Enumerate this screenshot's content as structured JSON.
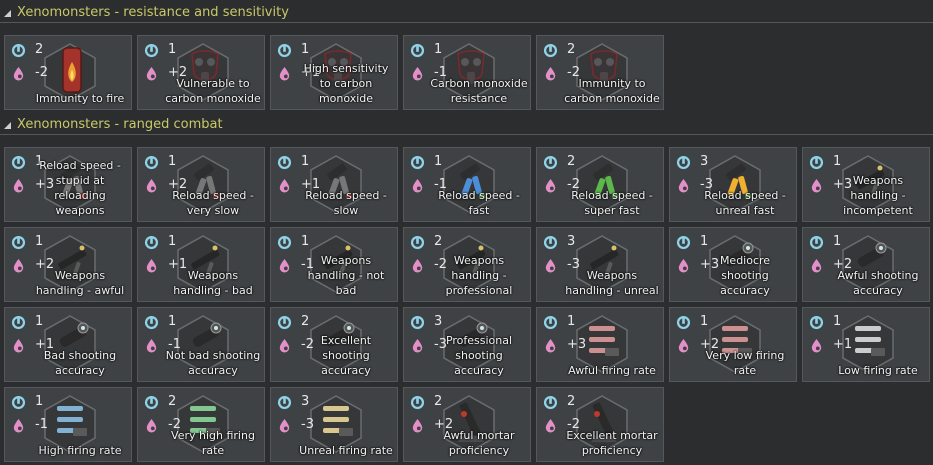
{
  "sections": [
    {
      "title": "Xenomonsters - resistance and sensitivity",
      "cards": [
        {
          "complexity": "2",
          "sensitivity": "-2",
          "label": "Immunity to fire",
          "art": "fire-immunity-icon"
        },
        {
          "complexity": "1",
          "sensitivity": "+2",
          "label": "Vulnerable to carbon monoxide",
          "art": "gas-mask-icon"
        },
        {
          "complexity": "1",
          "sensitivity": "+1",
          "label": "High sensitivity to carbon monoxide",
          "art": "gas-mask-icon"
        },
        {
          "complexity": "1",
          "sensitivity": "-1",
          "label": "Carbon monoxide resistance",
          "art": "gas-mask-icon"
        },
        {
          "complexity": "2",
          "sensitivity": "-2",
          "label": "Immunity to carbon monoxide",
          "art": "gas-mask-icon"
        }
      ]
    },
    {
      "title": "Xenomonsters - ranged combat",
      "cards": [
        {
          "complexity": "1",
          "sensitivity": "+3",
          "label": "Reload speed - stupid at reloading weapons",
          "art": "reload-icon"
        },
        {
          "complexity": "1",
          "sensitivity": "+2",
          "label": "Reload speed - very slow",
          "art": "reload-icon"
        },
        {
          "complexity": "1",
          "sensitivity": "+1",
          "label": "Reload speed - slow",
          "art": "reload-icon"
        },
        {
          "complexity": "1",
          "sensitivity": "-1",
          "label": "Reload speed - fast",
          "art": "reload-icon"
        },
        {
          "complexity": "2",
          "sensitivity": "-2",
          "label": "Reload speed - super fast",
          "art": "reload-icon"
        },
        {
          "complexity": "3",
          "sensitivity": "-3",
          "label": "Reload speed - unreal fast",
          "art": "reload-icon"
        },
        {
          "complexity": "1",
          "sensitivity": "+3",
          "label": "Weapons handling - incompetent",
          "art": "weapon-handling-icon"
        },
        {
          "complexity": "1",
          "sensitivity": "+2",
          "label": "Weapons handling - awful",
          "art": "weapon-handling-icon"
        },
        {
          "complexity": "1",
          "sensitivity": "+1",
          "label": "Weapons handling - bad",
          "art": "weapon-handling-icon"
        },
        {
          "complexity": "1",
          "sensitivity": "-1",
          "label": "Weapons handling - not bad",
          "art": "weapon-handling-icon"
        },
        {
          "complexity": "2",
          "sensitivity": "-2",
          "label": "Weapons handling - professional",
          "art": "weapon-handling-icon"
        },
        {
          "complexity": "3",
          "sensitivity": "-3",
          "label": "Weapons handling - unreal",
          "art": "weapon-handling-icon"
        },
        {
          "complexity": "1",
          "sensitivity": "+3",
          "label": "Mediocre shooting accuracy",
          "art": "scope-icon"
        },
        {
          "complexity": "1",
          "sensitivity": "+2",
          "label": "Awful shooting accuracy",
          "art": "scope-icon"
        },
        {
          "complexity": "1",
          "sensitivity": "+1",
          "label": "Bad shooting accuracy",
          "art": "scope-icon"
        },
        {
          "complexity": "1",
          "sensitivity": "-1",
          "label": "Not bad shooting accuracy",
          "art": "scope-icon"
        },
        {
          "complexity": "2",
          "sensitivity": "-2",
          "label": "Excellent shooting accuracy",
          "art": "scope-icon"
        },
        {
          "complexity": "3",
          "sensitivity": "-3",
          "label": "Professional shooting accuracy",
          "art": "scope-icon"
        },
        {
          "complexity": "1",
          "sensitivity": "+3",
          "label": "Awful firing rate",
          "art": "firing-rate-icon"
        },
        {
          "complexity": "1",
          "sensitivity": "+2",
          "label": "Very low firing rate",
          "art": "firing-rate-icon"
        },
        {
          "complexity": "1",
          "sensitivity": "+1",
          "label": "Low firing rate",
          "art": "firing-rate-icon"
        },
        {
          "complexity": "1",
          "sensitivity": "-1",
          "label": "High firing rate",
          "art": "firing-rate-icon"
        },
        {
          "complexity": "2",
          "sensitivity": "-2",
          "label": "Very high firing rate",
          "art": "firing-rate-icon"
        },
        {
          "complexity": "3",
          "sensitivity": "-3",
          "label": "Unreal firing rate",
          "art": "firing-rate-icon"
        },
        {
          "complexity": "2",
          "sensitivity": "+2",
          "label": "Awful mortar proficiency",
          "art": "mortar-icon"
        },
        {
          "complexity": "2",
          "sensitivity": "-2",
          "label": "Excellent mortar proficiency",
          "art": "mortar-icon"
        }
      ]
    }
  ],
  "colors": {
    "background": "#2b2d2e",
    "card": "#3f4244",
    "header_text": "#c9c96a",
    "complexity_icon": "#8fd3e8",
    "sensitivity_icon": "#e58fc8",
    "rating_good": "#5cc24a",
    "rating_bad": "#c0392b"
  }
}
